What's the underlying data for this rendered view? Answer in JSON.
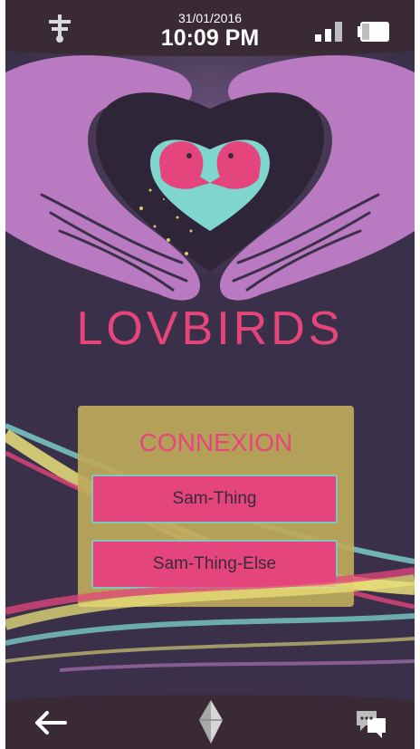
{
  "status_bar": {
    "date": "31/01/2016",
    "time": "10:09 PM",
    "left_icon": "usb-icon",
    "signal_icon": "signal-icon",
    "battery_icon": "battery-icon"
  },
  "app": {
    "title": "LOVBIRDS",
    "logo": "heart-hands-lovebirds-illustration"
  },
  "login": {
    "heading": "CONNEXION",
    "users": [
      "Sam-Thing",
      "Sam-Thing-Else"
    ]
  },
  "nav_bar": {
    "back_icon": "back-arrow-icon",
    "home_icon": "diamond-home-icon",
    "chat_icon": "chat-icon"
  },
  "colors": {
    "background": "#3b304a",
    "accent_pink": "#e4457c",
    "panel": "#beaa5a",
    "hands": "#b97ac2",
    "heart": "#7fd6cf"
  }
}
